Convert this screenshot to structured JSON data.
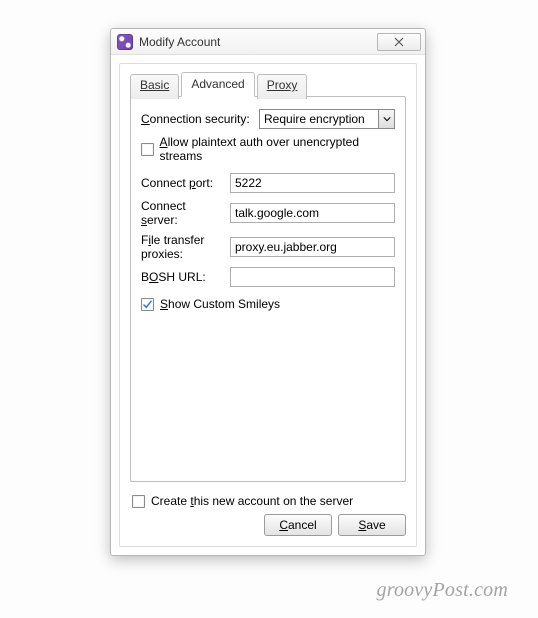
{
  "window": {
    "title": "Modify Account"
  },
  "tabs": {
    "basic": "Basic",
    "advanced": "Advanced",
    "proxy": "Proxy"
  },
  "labels": {
    "connection_security_pre": "C",
    "connection_security_rest": "onnection security:",
    "allow_plaintext_pre": "A",
    "allow_plaintext_rest": "llow plaintext auth over unencrypted streams",
    "connect_port_pre": "Connect ",
    "connect_port_u": "p",
    "connect_port_rest": "ort:",
    "connect_server_pre": "Connect ",
    "connect_server_u": "s",
    "connect_server_rest": "erver:",
    "file_proxies_pre": "F",
    "file_proxies_u": "i",
    "file_proxies_rest": "le transfer proxies:",
    "bosh_pre": "B",
    "bosh_u": "O",
    "bosh_rest": "SH URL:",
    "show_smileys": "Show Custom Smileys",
    "create_account_pre": "Create ",
    "create_account_u": "t",
    "create_account_rest": "his new account on the server"
  },
  "values": {
    "connection_security": "Require encryption",
    "connect_port": "5222",
    "connect_server": "talk.google.com",
    "file_transfer_proxies": "proxy.eu.jabber.org",
    "bosh_url": ""
  },
  "checkboxes": {
    "allow_plaintext": false,
    "show_custom_smileys": true,
    "create_on_server": false
  },
  "buttons": {
    "cancel_pre": "C",
    "cancel_rest": "ancel",
    "save_pre": "S",
    "save_rest": "ave"
  },
  "watermark": "groovyPost.com"
}
